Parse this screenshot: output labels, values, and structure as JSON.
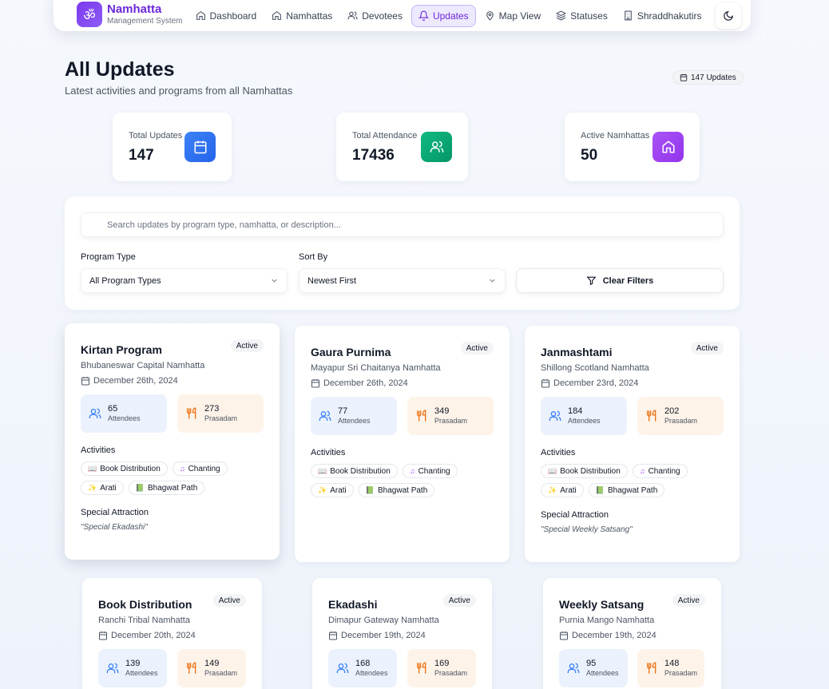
{
  "nav": {
    "brand_name": "Namhatta",
    "brand_sub": "Management System",
    "items": [
      {
        "label": "Dashboard"
      },
      {
        "label": "Namhattas"
      },
      {
        "label": "Devotees"
      },
      {
        "label": "Updates"
      },
      {
        "label": "Map View"
      },
      {
        "label": "Statuses"
      },
      {
        "label": "Shraddhakutirs"
      }
    ]
  },
  "header": {
    "title": "All Updates",
    "subtitle": "Latest activities and programs from all Namhattas",
    "count_badge": "147 Updates"
  },
  "stats": [
    {
      "label": "Total Updates",
      "value": "147",
      "color": "#3b82f6"
    },
    {
      "label": "Total Attendance",
      "value": "17436",
      "color": "#10b981"
    },
    {
      "label": "Active Namhattas",
      "value": "50",
      "color": "#a855f7"
    }
  ],
  "filters": {
    "search_placeholder": "Search updates by program type, namhatta, or description...",
    "program_type_label": "Program Type",
    "program_type_value": "All Program Types",
    "sort_label": "Sort By",
    "sort_value": "Newest First",
    "clear_label": "Clear Filters"
  },
  "labels": {
    "attendees": "Attendees",
    "prasadam": "Prasadam",
    "activities": "Activities",
    "special": "Special Attraction"
  },
  "cards": [
    {
      "title": "Kirtan Program",
      "status": "Active",
      "location": "Bhubaneswar Capital Namhatta",
      "date": "December 26th, 2024",
      "attendees": "65",
      "prasadam": "273",
      "activities": [
        "Book Distribution",
        "Chanting",
        "Arati",
        "Bhagwat Path"
      ],
      "special": "\"Special Ekadashi\""
    },
    {
      "title": "Gaura Purnima",
      "status": "Active",
      "location": "Mayapur Sri Chaitanya Namhatta",
      "date": "December 26th, 2024",
      "attendees": "77",
      "prasadam": "349",
      "activities": [
        "Book Distribution",
        "Chanting",
        "Arati",
        "Bhagwat Path"
      ],
      "special": ""
    },
    {
      "title": "Janmashtami",
      "status": "Active",
      "location": "Shillong Scotland Namhatta",
      "date": "December 23rd, 2024",
      "attendees": "184",
      "prasadam": "202",
      "activities": [
        "Book Distribution",
        "Chanting",
        "Arati",
        "Bhagwat Path"
      ],
      "special": "\"Special Weekly Satsang\""
    },
    {
      "title": "Book Distribution",
      "status": "Active",
      "location": "Ranchi Tribal Namhatta",
      "date": "December 20th, 2024",
      "attendees": "139",
      "prasadam": "149"
    },
    {
      "title": "Ekadashi",
      "status": "Active",
      "location": "Dimapur Gateway Namhatta",
      "date": "December 19th, 2024",
      "attendees": "168",
      "prasadam": "169"
    },
    {
      "title": "Weekly Satsang",
      "status": "Active",
      "location": "Purnia Mango Namhatta",
      "date": "December 19th, 2024",
      "attendees": "95",
      "prasadam": "148"
    }
  ]
}
